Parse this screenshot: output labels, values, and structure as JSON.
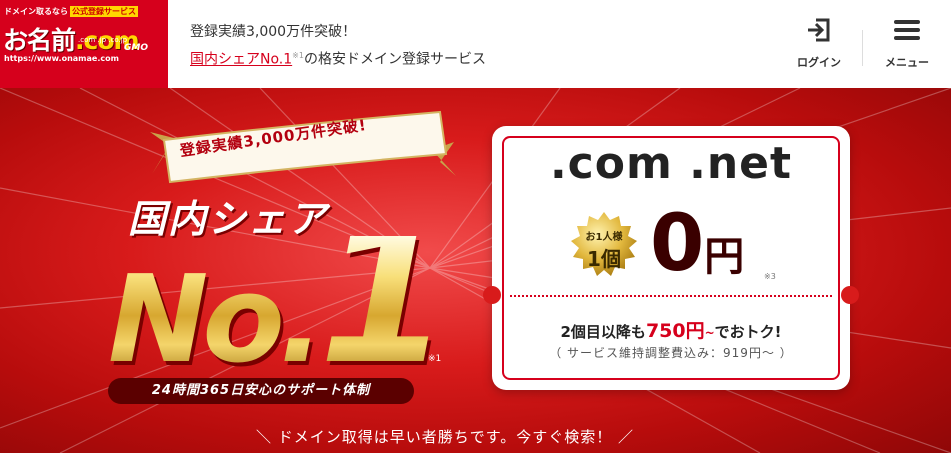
{
  "header": {
    "logo": {
      "tagline": "ドメイン取るなら",
      "badge": "公式登録サービス",
      "name_prefix": "お名前",
      "name_suffix": ".com",
      "domains": ".com .jp .co.jp",
      "url": "https://www.onamae.com",
      "brand": "GMO"
    },
    "line1": "登録実績3,000万件突破！",
    "line2_link": "国内シェアNo.1",
    "line2_note": "※1",
    "line2_rest": "の格安ドメイン登録サービス",
    "login_label": "ログイン",
    "menu_label": "メニュー"
  },
  "hero": {
    "ribbon": "登録実績3,000万件突破!",
    "share": "国内シェア",
    "no": "No.",
    "one": "1",
    "note1": "※1",
    "support": "24時間365日安心のサポート体制",
    "cta": "＼ ドメイン取得は早い者勝ちです。今すぐ検索！ ／"
  },
  "card": {
    "tlds": ".com .net",
    "seal_line1": "お1人様",
    "seal_line2": "1個",
    "price_value": "0",
    "price_unit": "円",
    "note3": "※3",
    "after_prefix": "2個目以降も",
    "after_price": "750円",
    "after_tilde": "~",
    "after_suffix": "でおトク!",
    "fee": "（ サービス維持調整費込み：919円～ ）"
  },
  "colors": {
    "brand_red": "#d6001c",
    "gold": "#d7a730",
    "dark_red": "#5b0000"
  }
}
